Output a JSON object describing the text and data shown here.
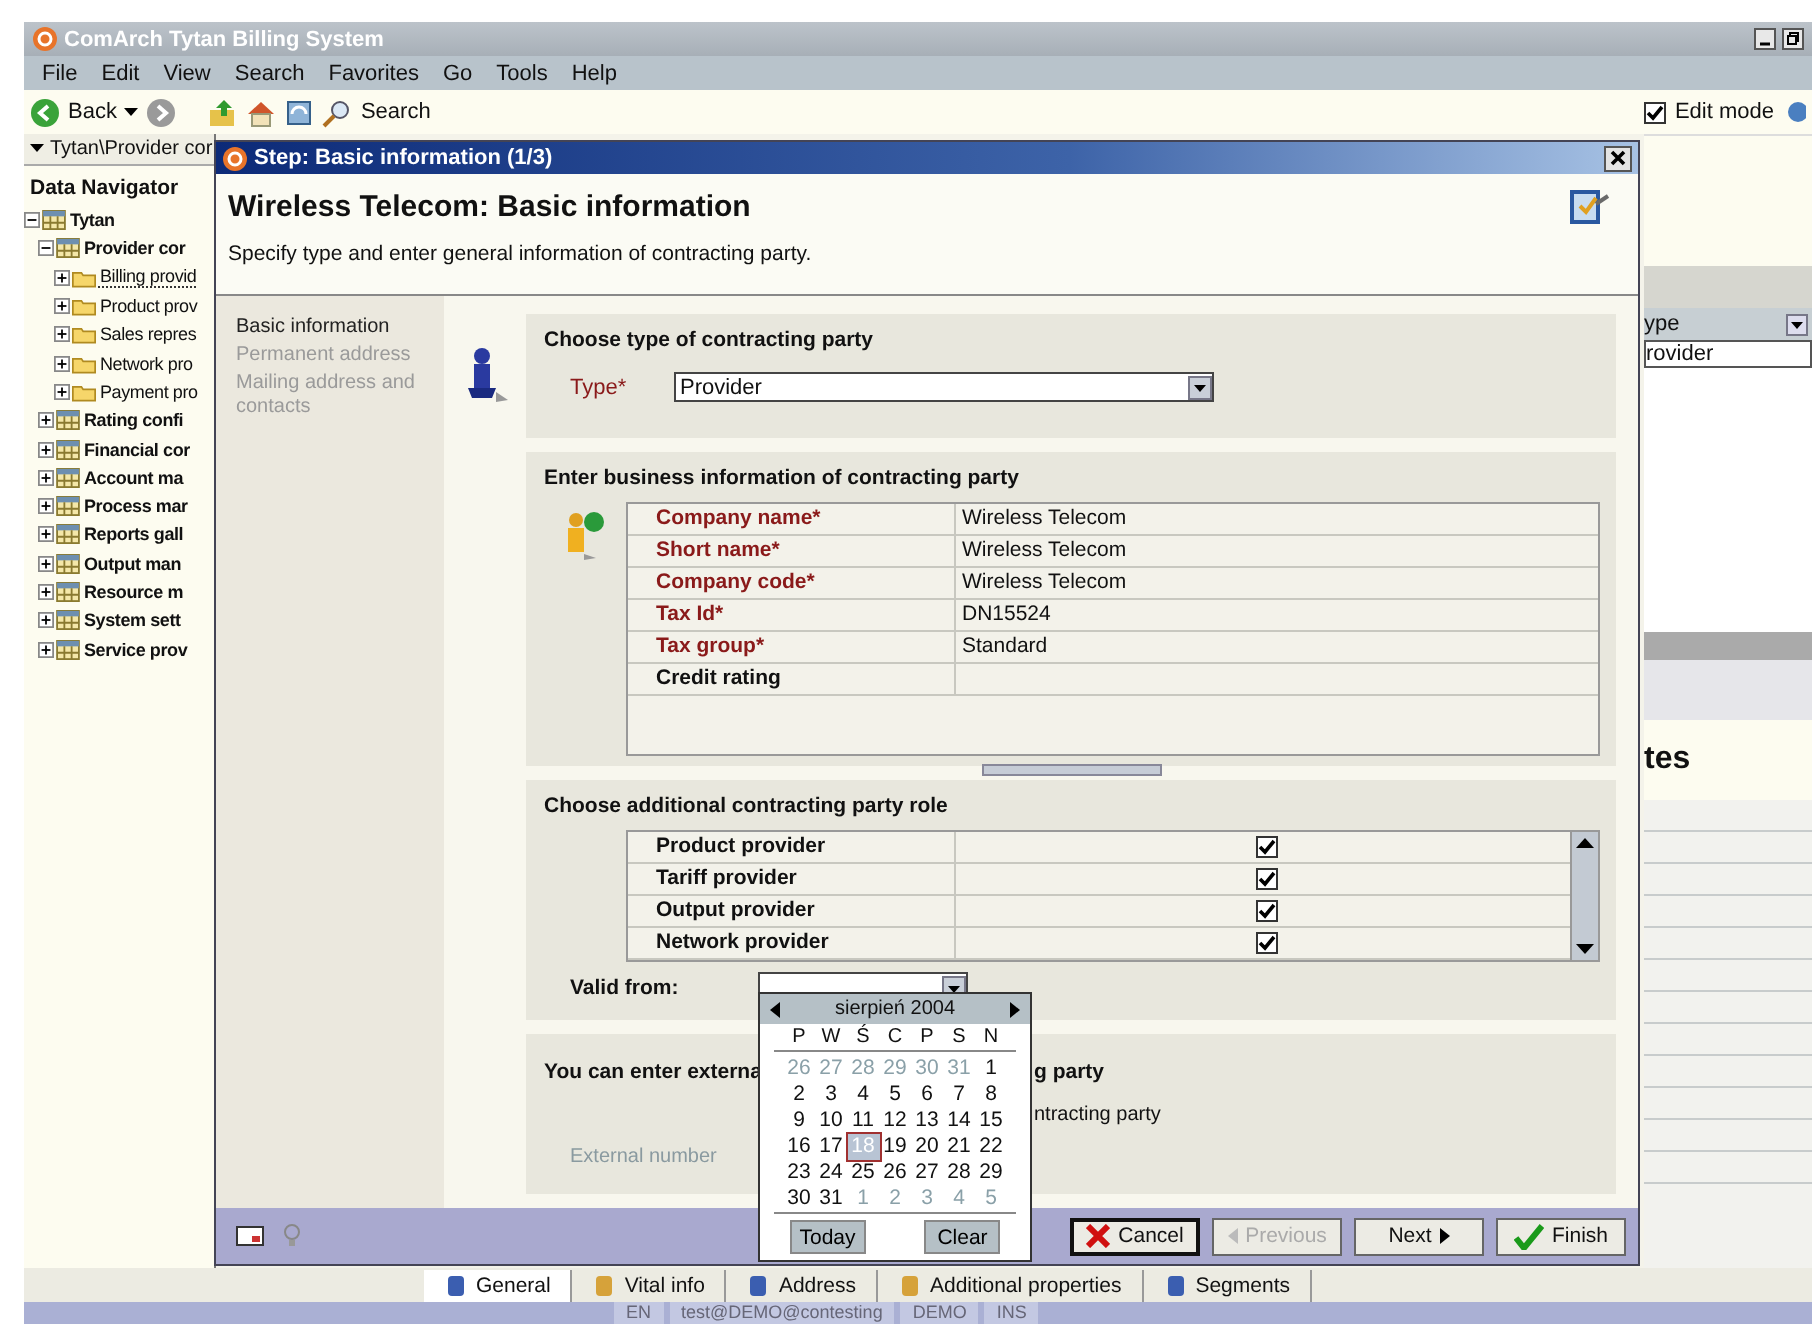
{
  "window": {
    "title": "ComArch Tytan Billing System"
  },
  "menu": [
    "File",
    "Edit",
    "View",
    "Search",
    "Favorites",
    "Go",
    "Tools",
    "Help"
  ],
  "toolbar": {
    "back": "Back",
    "search": "Search",
    "edit_mode": {
      "label": "Edit mode",
      "checked": true
    }
  },
  "navigator": {
    "address": "Tytan\\Provider cor",
    "title": "Data Navigator",
    "tree": [
      {
        "label": "Tytan",
        "expanded": true,
        "selected": false,
        "children": [
          {
            "label": "Provider cor",
            "expanded": true,
            "selected": false,
            "children": [
              {
                "label": "Billing provid",
                "expanded": false,
                "selected": true
              },
              {
                "label": "Product prov",
                "expanded": false,
                "selected": false
              },
              {
                "label": "Sales repres",
                "expanded": false,
                "selected": false
              },
              {
                "label": "Network pro",
                "expanded": false,
                "selected": false
              },
              {
                "label": "Payment pro",
                "expanded": false,
                "selected": false
              }
            ]
          },
          {
            "label": "Rating confi",
            "expanded": false,
            "selected": false
          },
          {
            "label": "Financial cor",
            "expanded": false,
            "selected": false
          },
          {
            "label": "Account ma",
            "expanded": false,
            "selected": false
          },
          {
            "label": "Process mar",
            "expanded": false,
            "selected": false
          },
          {
            "label": "Reports gall",
            "expanded": false,
            "selected": false
          },
          {
            "label": "Output man",
            "expanded": false,
            "selected": false
          },
          {
            "label": "Resource m",
            "expanded": false,
            "selected": false
          },
          {
            "label": "System sett",
            "expanded": false,
            "selected": false
          },
          {
            "label": "Service prov",
            "expanded": false,
            "selected": false
          }
        ]
      }
    ]
  },
  "background": {
    "column_header": "ype",
    "cell": "rovider",
    "heading": "tes"
  },
  "dialog": {
    "title": "Step: Basic information (1/3)",
    "heading": "Wireless Telecom: Basic information",
    "subtitle": "Specify type and enter general information of contracting party.",
    "steps": [
      {
        "label": "Basic information",
        "selected": true
      },
      {
        "label": "Permanent address",
        "selected": false
      },
      {
        "label": "Mailing address and contacts",
        "selected": false
      }
    ],
    "type_section": {
      "heading": "Choose type of contracting party",
      "label": "Type*",
      "value": "Provider"
    },
    "business_section": {
      "heading": "Enter business information of contracting party",
      "rows": [
        {
          "label": "Company name*",
          "value": "Wireless Telecom",
          "required": true
        },
        {
          "label": "Short name*",
          "value": "Wireless Telecom",
          "required": true
        },
        {
          "label": "Company code*",
          "value": "Wireless Telecom",
          "required": true
        },
        {
          "label": "Tax Id*",
          "value": "DN15524",
          "required": true
        },
        {
          "label": "Tax group*",
          "value": "Standard",
          "required": true
        },
        {
          "label": "Credit rating",
          "required": false
        }
      ]
    },
    "roles_section": {
      "heading": "Choose additional contracting party role",
      "rows": [
        {
          "label": "Product provider",
          "checked": true
        },
        {
          "label": "Tariff provider",
          "checked": true
        },
        {
          "label": "Output provider",
          "checked": true
        },
        {
          "label": "Network provider",
          "checked": true
        }
      ],
      "valid_from_label": "Valid from:"
    },
    "external_section": {
      "heading_start": "You can enter externa",
      "heading_end": "g party",
      "line_end": "ntracting party",
      "field_label": "External number"
    },
    "calendar": {
      "month": "sierpień 2004",
      "weekdays": [
        "P",
        "W",
        "Ś",
        "C",
        "P",
        "S",
        "N"
      ],
      "weeks": [
        [
          {
            "day": "26",
            "muted": true,
            "selected": false
          },
          {
            "day": "27",
            "muted": true,
            "selected": false
          },
          {
            "day": "28",
            "muted": true,
            "selected": false
          },
          {
            "day": "29",
            "muted": true,
            "selected": false
          },
          {
            "day": "30",
            "muted": true,
            "selected": false
          },
          {
            "day": "31",
            "muted": true,
            "selected": false
          },
          {
            "day": "1",
            "muted": false,
            "selected": false
          }
        ],
        [
          {
            "day": "2",
            "muted": false,
            "selected": false
          },
          {
            "day": "3",
            "muted": false,
            "selected": false
          },
          {
            "day": "4",
            "muted": false,
            "selected": false
          },
          {
            "day": "5",
            "muted": false,
            "selected": false
          },
          {
            "day": "6",
            "muted": false,
            "selected": false
          },
          {
            "day": "7",
            "muted": false,
            "selected": false
          },
          {
            "day": "8",
            "muted": false,
            "selected": false
          }
        ],
        [
          {
            "day": "9",
            "muted": false,
            "selected": false
          },
          {
            "day": "10",
            "muted": false,
            "selected": false
          },
          {
            "day": "11",
            "muted": false,
            "selected": false
          },
          {
            "day": "12",
            "muted": false,
            "selected": false
          },
          {
            "day": "13",
            "muted": false,
            "selected": false
          },
          {
            "day": "14",
            "muted": false,
            "selected": false
          },
          {
            "day": "15",
            "muted": false,
            "selected": false
          }
        ],
        [
          {
            "day": "16",
            "muted": false,
            "selected": false
          },
          {
            "day": "17",
            "muted": false,
            "selected": false
          },
          {
            "day": "18",
            "muted": false,
            "selected": true
          },
          {
            "day": "19",
            "muted": false,
            "selected": false
          },
          {
            "day": "20",
            "muted": false,
            "selected": false
          },
          {
            "day": "21",
            "muted": false,
            "selected": false
          },
          {
            "day": "22",
            "muted": false,
            "selected": false
          }
        ],
        [
          {
            "day": "23",
            "muted": false,
            "selected": false
          },
          {
            "day": "24",
            "muted": false,
            "selected": false
          },
          {
            "day": "25",
            "muted": false,
            "selected": false
          },
          {
            "day": "26",
            "muted": false,
            "selected": false
          },
          {
            "day": "27",
            "muted": false,
            "selected": false
          },
          {
            "day": "28",
            "muted": false,
            "selected": false
          },
          {
            "day": "29",
            "muted": false,
            "selected": false
          }
        ],
        [
          {
            "day": "30",
            "muted": false,
            "selected": false
          },
          {
            "day": "31",
            "muted": false,
            "selected": false
          },
          {
            "day": "1",
            "muted": true,
            "selected": false
          },
          {
            "day": "2",
            "muted": true,
            "selected": false
          },
          {
            "day": "3",
            "muted": true,
            "selected": false
          },
          {
            "day": "4",
            "muted": true,
            "selected": false
          },
          {
            "day": "5",
            "muted": true,
            "selected": false
          }
        ]
      ],
      "buttons": [
        "Today",
        "Clear"
      ]
    },
    "buttons": [
      {
        "label": "Cancel",
        "kind": "cancel",
        "disabled": false
      },
      {
        "label": "Previous",
        "kind": "previous",
        "disabled": true
      },
      {
        "label": "Next",
        "kind": "next",
        "disabled": false
      },
      {
        "label": "Finish",
        "kind": "finish",
        "disabled": false
      }
    ]
  },
  "bottom_tabs": [
    {
      "label": "General",
      "selected": true
    },
    {
      "label": "Vital info",
      "selected": false
    },
    {
      "label": "Address",
      "selected": false
    },
    {
      "label": "Additional properties",
      "selected": false
    },
    {
      "label": "Segments",
      "selected": false
    }
  ],
  "status_bar": [
    "EN",
    "test@DEMO@contesting",
    "DEMO",
    "INS"
  ]
}
